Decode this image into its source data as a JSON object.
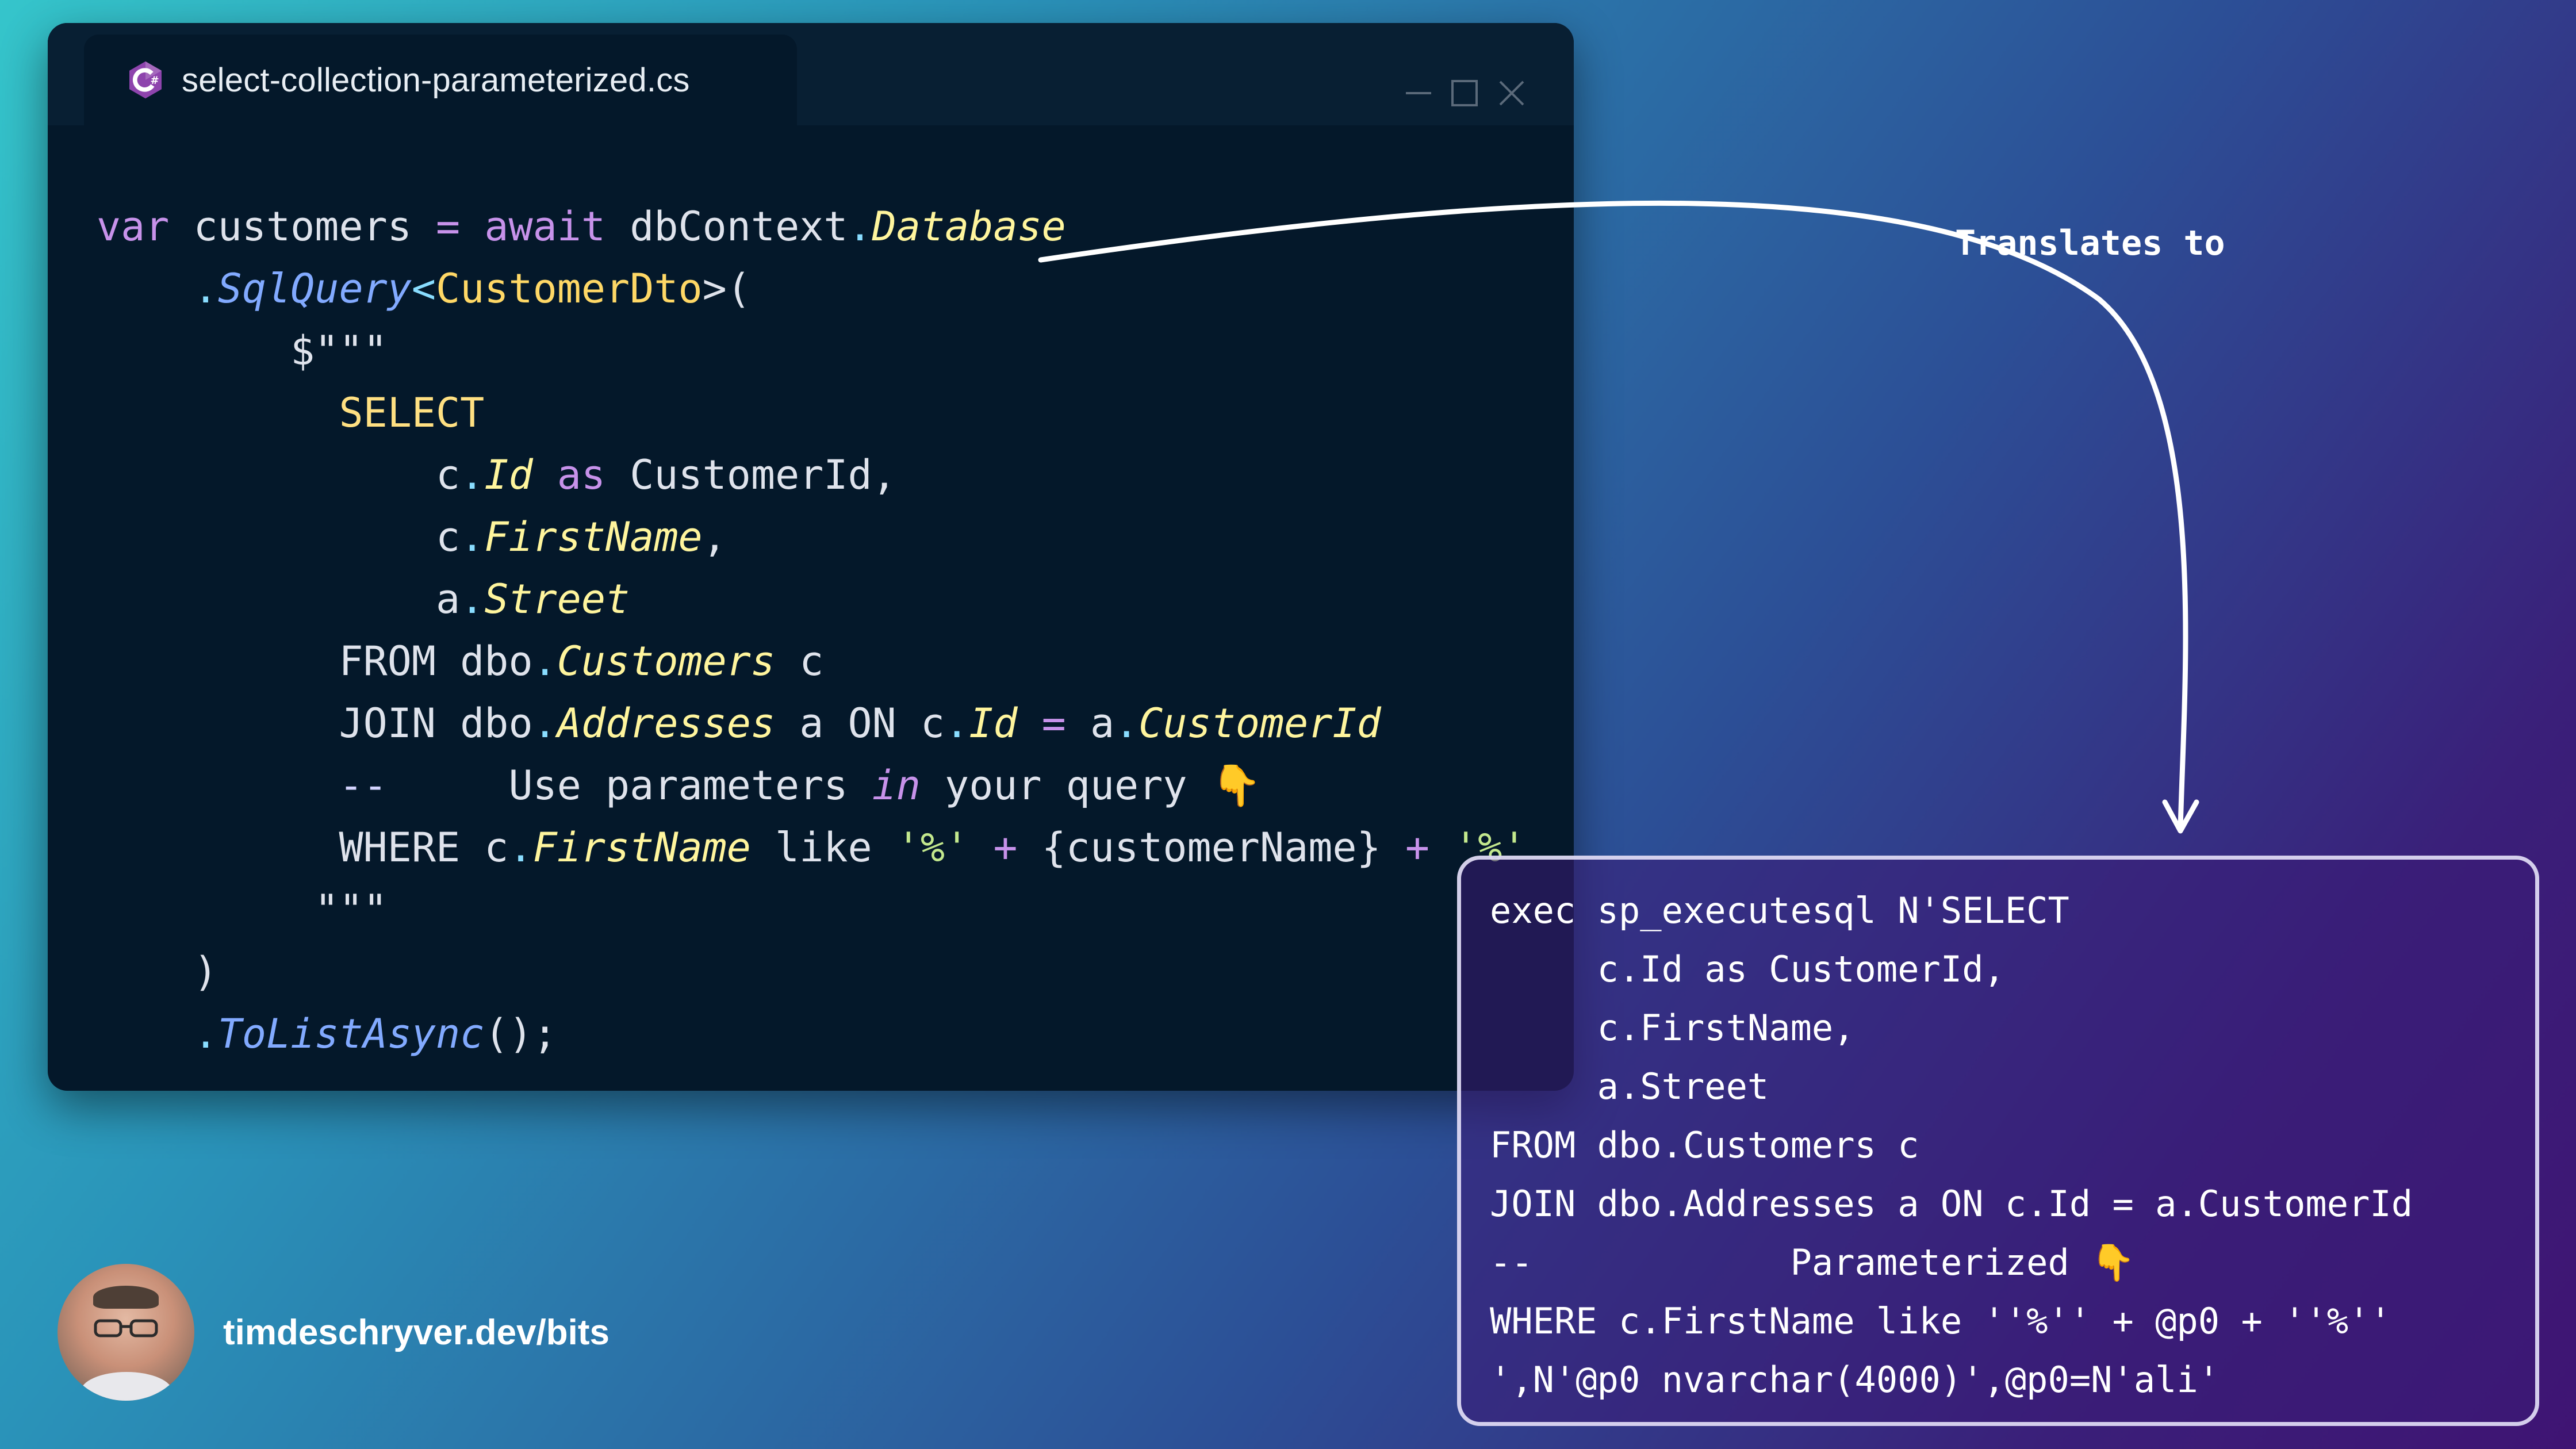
{
  "window": {
    "tab_title": "select-collection-parameterized.cs",
    "tab_icon": "csharp-icon"
  },
  "code": {
    "line1": {
      "var": "var",
      "name": " customers ",
      "eq": "=",
      "await": " await",
      "ctx": " dbContext",
      "dot": ".",
      "prop": "Database"
    },
    "line2": {
      "dot": ".",
      "method": "SqlQuery",
      "lt": "<",
      "type": "CustomerDto",
      "rest": ">("
    },
    "line3": "$\"\"\"",
    "line4": "SELECT",
    "line5": {
      "a": "c",
      "dot": ".",
      "prop": "Id",
      "as": " as",
      "rest": " CustomerId,"
    },
    "line6": {
      "a": "c",
      "dot": ".",
      "prop": "FirstName",
      "rest": ","
    },
    "line7": {
      "a": "a",
      "dot": ".",
      "prop": "Street"
    },
    "line8": {
      "a": "FROM dbo",
      "dot": ".",
      "prop": "Customers",
      "rest": " c"
    },
    "line9": {
      "a": "JOIN dbo",
      "dot": ".",
      "prop": "Addresses",
      "mid": " a ON c",
      "dot2": ".",
      "prop2": "Id",
      "eq": " = ",
      "b": "a",
      "dot3": ".",
      "prop3": "CustomerId"
    },
    "line10": {
      "dash": "--",
      "text": "     Use parameters ",
      "in": "in",
      "rest": " your query ",
      "emoji": "👇"
    },
    "line11": {
      "a": "WHERE c",
      "dot": ".",
      "prop": "FirstName",
      "like": " like ",
      "s1": "'%'",
      "plus1": " + ",
      "param": "{customerName}",
      "plus2": " + ",
      "s2": "'%'"
    },
    "line12": "\"\"\"",
    "line13": ")",
    "line14": {
      "dot": ".",
      "method": "ToListAsync",
      "rest": "();"
    }
  },
  "annotation": "Translates to",
  "sql": {
    "lines": [
      "exec sp_executesql N'SELECT",
      "     c.Id as CustomerId,",
      "     c.FirstName,",
      "     a.Street",
      "FROM dbo.Customers c",
      "JOIN dbo.Addresses a ON c.Id = a.CustomerId",
      "--            Parameterized 👇",
      "WHERE c.FirstName like ''%'' + @p0 + ''%''",
      "',N'@p0 nvarchar(4000)',@p0=N'ali'"
    ]
  },
  "author": {
    "link": "timdeschryver.dev/bits",
    "avatar_icon": "avatar-photo"
  },
  "colors": {
    "keyword": "#c792ea",
    "property": "#fff59d",
    "method": "#82aaff",
    "type": "#ffd866",
    "string": "#c3e88d",
    "window_bg": "#04182a"
  }
}
